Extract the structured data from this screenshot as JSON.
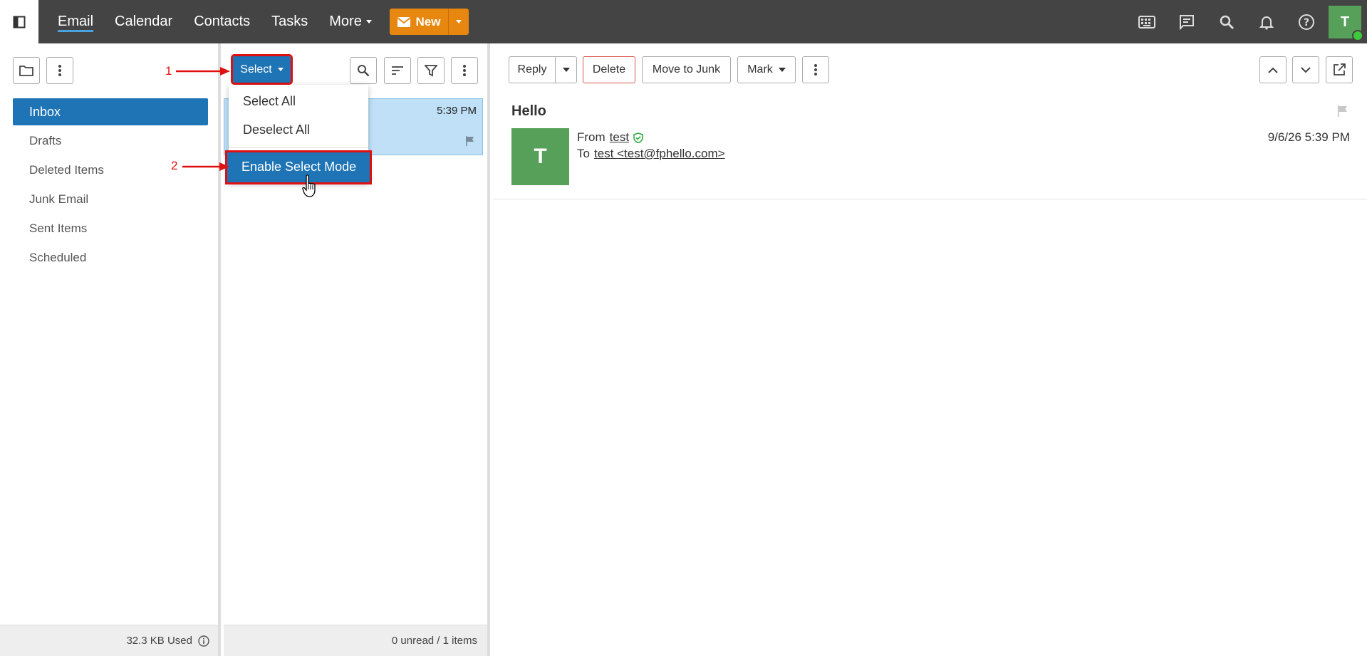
{
  "nav": {
    "items": [
      "Email",
      "Calendar",
      "Contacts",
      "Tasks",
      "More"
    ],
    "new_label": "New",
    "avatar_initial": "T"
  },
  "icons": {
    "sidebar_toggle": "sidebar-toggle-icon",
    "top_right": [
      "keyboard-icon",
      "chat-icon",
      "search-icon",
      "bell-icon",
      "help-icon"
    ]
  },
  "folders": {
    "items": [
      "Inbox",
      "Drafts",
      "Deleted Items",
      "Junk Email",
      "Sent Items",
      "Scheduled"
    ],
    "selected": "Inbox",
    "storage_used": "32.3 KB Used"
  },
  "list": {
    "select_label": "Select",
    "dropdown": [
      "Select All",
      "Deselect All",
      "Enable Select Mode"
    ],
    "message_time": "5:39 PM",
    "footer": "0 unread / 1 items"
  },
  "reading": {
    "toolbar": {
      "reply": "Reply",
      "delete": "Delete",
      "move_to_junk": "Move to Junk",
      "mark": "Mark"
    },
    "subject": "Hello",
    "sender_initial": "T",
    "from_label": "From",
    "from_name": "test",
    "to_label": "To",
    "to_value": "test <test@fphello.com>",
    "date": "9/6/26 5:39 PM"
  },
  "annotations": [
    "1",
    "2"
  ],
  "colors": {
    "topbar": "#444444",
    "accent_blue": "#1e74b5",
    "new_orange": "#e8870f",
    "avatar_green": "#56a05a",
    "annotation_red": "#e01010"
  }
}
